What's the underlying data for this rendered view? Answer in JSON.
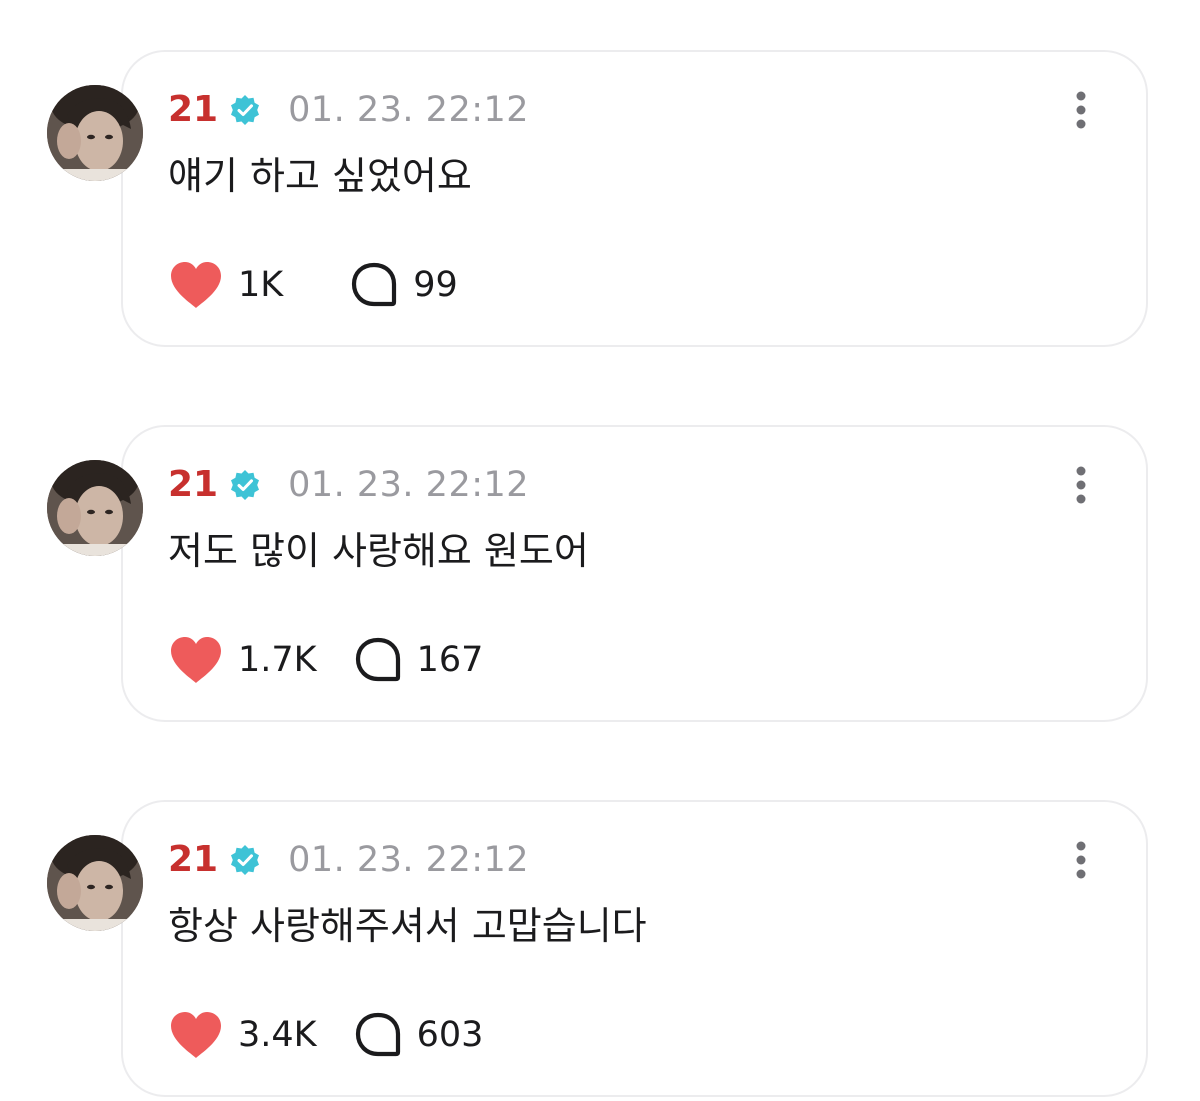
{
  "colors": {
    "author_name": "#c7302e",
    "verified_badge": "#3ec3d6",
    "heart": "#ee5b5b",
    "timestamp": "#9a9a9f",
    "card_border": "#ececee",
    "text": "#1b1b1d"
  },
  "icons": {
    "verified": "verified-badge-icon",
    "more": "vertical-ellipsis-icon",
    "like": "heart-icon",
    "comment": "speech-bubble-icon"
  },
  "posts": [
    {
      "author": "21",
      "timestamp": "01. 23. 22:12",
      "text": "얘기 하고 싶었어요",
      "likes": "1K",
      "comments": "99"
    },
    {
      "author": "21",
      "timestamp": "01. 23. 22:12",
      "text": "저도 많이 사랑해요 원도어",
      "likes": "1.7K",
      "comments": "167"
    },
    {
      "author": "21",
      "timestamp": "01. 23. 22:12",
      "text": "항상 사랑해주셔서 고맙습니다",
      "likes": "3.4K",
      "comments": "603"
    }
  ]
}
